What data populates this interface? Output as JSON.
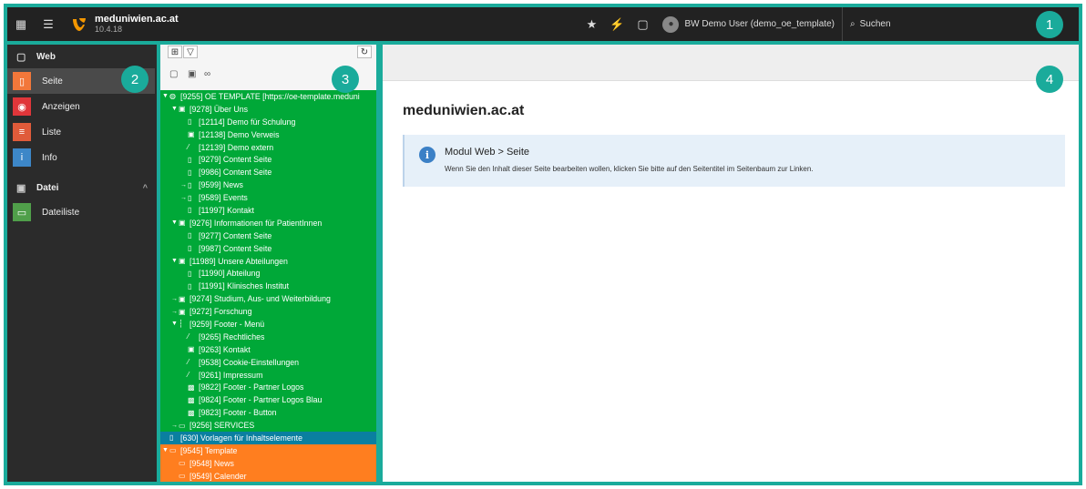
{
  "topbar": {
    "site_name": "meduniwien.ac.at",
    "version": "10.4.18",
    "user_label": "BW Demo User (demo_oe_template)",
    "search_label": "Suchen"
  },
  "badges": [
    "1",
    "2",
    "3",
    "4"
  ],
  "modules": {
    "web_group": "Web",
    "items_web": [
      {
        "label": "Seite",
        "color": "#f2773a",
        "icon": "page-icon"
      },
      {
        "label": "Anzeigen",
        "color": "#e0363a",
        "icon": "eye-icon"
      },
      {
        "label": "Liste",
        "color": "#e05b3a",
        "icon": "list-icon"
      },
      {
        "label": "Info",
        "color": "#3d87c8",
        "icon": "info-icon"
      }
    ],
    "file_group": "Datei",
    "items_file": [
      {
        "label": "Dateiliste",
        "color": "#509f4a",
        "icon": "folder-icon"
      }
    ]
  },
  "tree": [
    {
      "text": "[9255] OE TEMPLATE [https://oe-template.meduni",
      "depth": 0,
      "toggle": "▼",
      "icon": "globe-icon",
      "state": "normal"
    },
    {
      "text": "[9278] Über Uns",
      "depth": 1,
      "toggle": "▼",
      "icon": "folder-page-icon",
      "state": "normal"
    },
    {
      "text": "[12114] Demo für Schulung",
      "depth": 2,
      "toggle": "",
      "icon": "page-icon",
      "state": "normal"
    },
    {
      "text": "[12138] Demo Verweis",
      "depth": 2,
      "toggle": "",
      "icon": "folder-page-icon",
      "state": "normal"
    },
    {
      "text": "[12139] Demo extern",
      "depth": 2,
      "toggle": "",
      "icon": "link-icon",
      "state": "normal"
    },
    {
      "text": "[9279] Content Seite",
      "depth": 2,
      "toggle": "",
      "icon": "page-icon",
      "state": "normal"
    },
    {
      "text": "[9986] Content Seite",
      "depth": 2,
      "toggle": "",
      "icon": "page-icon",
      "state": "normal"
    },
    {
      "text": "[9599] News",
      "depth": 2,
      "toggle": "→",
      "icon": "page-icon",
      "state": "normal"
    },
    {
      "text": "[9589] Events",
      "depth": 2,
      "toggle": "→",
      "icon": "page-icon",
      "state": "normal"
    },
    {
      "text": "[11997] Kontakt",
      "depth": 2,
      "toggle": "",
      "icon": "page-icon",
      "state": "normal"
    },
    {
      "text": "[9276] Informationen für PatientInnen",
      "depth": 1,
      "toggle": "▼",
      "icon": "folder-page-icon",
      "state": "normal"
    },
    {
      "text": "[9277] Content Seite",
      "depth": 2,
      "toggle": "",
      "icon": "page-icon",
      "state": "normal"
    },
    {
      "text": "[9987] Content Seite",
      "depth": 2,
      "toggle": "",
      "icon": "page-icon",
      "state": "normal"
    },
    {
      "text": "[11989] Unsere Abteilungen",
      "depth": 1,
      "toggle": "▼",
      "icon": "folder-page-icon",
      "state": "normal"
    },
    {
      "text": "[11990] Abteilung",
      "depth": 2,
      "toggle": "",
      "icon": "page-icon",
      "state": "normal"
    },
    {
      "text": "[11991] Klinisches Institut",
      "depth": 2,
      "toggle": "",
      "icon": "page-icon",
      "state": "normal"
    },
    {
      "text": "[9274] Studium, Aus- und Weiterbildung",
      "depth": 1,
      "toggle": "→",
      "icon": "folder-page-icon",
      "state": "normal"
    },
    {
      "text": "[9272] Forschung",
      "depth": 1,
      "toggle": "→",
      "icon": "folder-page-icon",
      "state": "normal"
    },
    {
      "text": "[9259] Footer - Menü",
      "depth": 1,
      "toggle": "▼",
      "icon": "spacer-icon",
      "state": "normal"
    },
    {
      "text": "[9265] Rechtliches",
      "depth": 2,
      "toggle": "",
      "icon": "link-icon",
      "state": "normal"
    },
    {
      "text": "[9263] Kontakt",
      "depth": 2,
      "toggle": "",
      "icon": "folder-page-icon",
      "state": "normal"
    },
    {
      "text": "[9538] Cookie-Einstellungen",
      "depth": 2,
      "toggle": "",
      "icon": "link-icon",
      "state": "normal"
    },
    {
      "text": "[9261] Impressum",
      "depth": 2,
      "toggle": "",
      "icon": "link-icon",
      "state": "normal"
    },
    {
      "text": "[9822] Footer - Partner Logos",
      "depth": 2,
      "toggle": "",
      "icon": "image-icon",
      "state": "normal"
    },
    {
      "text": "[9824] Footer - Partner Logos Blau",
      "depth": 2,
      "toggle": "",
      "icon": "image-icon",
      "state": "normal"
    },
    {
      "text": "[9823] Footer - Button",
      "depth": 2,
      "toggle": "",
      "icon": "image-icon",
      "state": "normal"
    },
    {
      "text": "[9256] SERVICES",
      "depth": 1,
      "toggle": "→",
      "icon": "folder-icon",
      "state": "normal"
    },
    {
      "text": "[630] Vorlagen für Inhaltselemente",
      "depth": 0,
      "toggle": "",
      "icon": "page-icon",
      "state": "selected"
    },
    {
      "text": "[9545] Template",
      "depth": 0,
      "toggle": "▼",
      "icon": "folder-icon",
      "state": "orange"
    },
    {
      "text": "[9548] News",
      "depth": 1,
      "toggle": "",
      "icon": "folder-icon",
      "state": "orange"
    },
    {
      "text": "[9549] Calender",
      "depth": 1,
      "toggle": "",
      "icon": "folder-icon",
      "state": "orange"
    }
  ],
  "content": {
    "title": "meduniwien.ac.at",
    "callout_title": "Modul Web > Seite",
    "callout_text": "Wenn Sie den Inhalt dieser Seite bearbeiten wollen, klicken Sie bitte auf den Seitentitel im Seitenbaum zur Linken."
  },
  "colors": {
    "accent": "#1aab9b",
    "tree_green": "#00a838",
    "tree_selected": "#0a7fa0",
    "tree_orange": "#ff7e1f"
  }
}
